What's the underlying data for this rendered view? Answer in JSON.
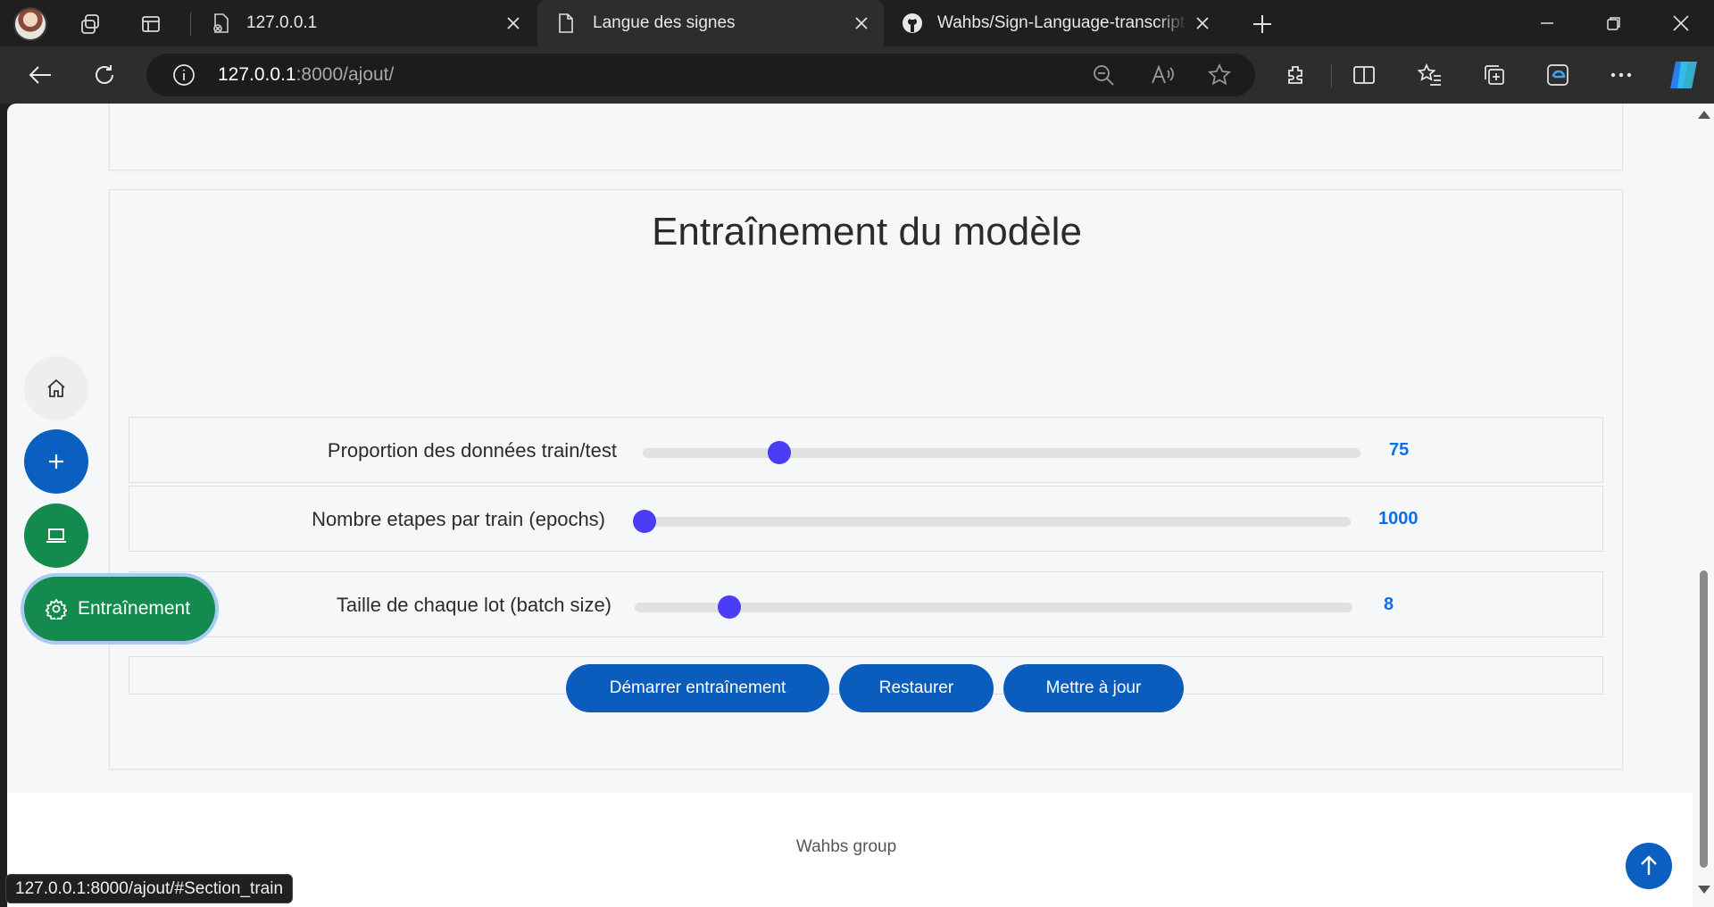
{
  "browser": {
    "tabs": [
      {
        "title": "127.0.0.1",
        "active": false
      },
      {
        "title": "Langue des signes",
        "active": true
      },
      {
        "title": "Wahbs/Sign-Language-transcript",
        "active": false
      }
    ],
    "url_host": "127.0.0.1",
    "url_rest": ":8000/ajout/",
    "status_url": "127.0.0.1:8000/ajout/#Section_train"
  },
  "section": {
    "title": "Entraînement du modèle"
  },
  "params": [
    {
      "label": "Proportion des données train/test",
      "value": "75",
      "level": 0.18
    },
    {
      "label": "Nombre etapes par train (epochs)",
      "value": "1000",
      "level": 0.0
    },
    {
      "label": "Taille de chaque lot (batch size)",
      "value": "8",
      "level": 0.12
    }
  ],
  "buttons": {
    "start": "Démarrer entraînement",
    "restore": "Restaurer",
    "update": "Mettre à jour"
  },
  "sidenav": {
    "active_label": "Entraînement"
  },
  "footer": {
    "text": "Wahbs group"
  },
  "colors": {
    "accent_blue": "#0a5dbd",
    "green": "#148a4f",
    "slider_thumb": "#4b3cf5",
    "value_blue": "#0b6fe8"
  }
}
